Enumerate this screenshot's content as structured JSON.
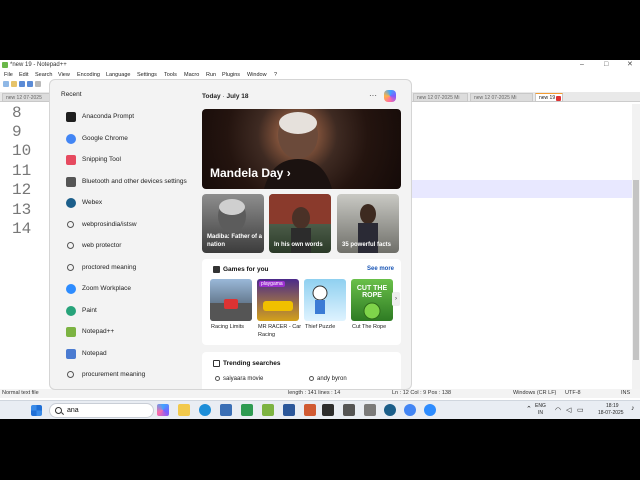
{
  "npp": {
    "title": "*new 19 - Notepad++",
    "controls": [
      "–",
      "□",
      "✕"
    ],
    "menu": [
      "File",
      "Edit",
      "Search",
      "View",
      "Encoding",
      "Language",
      "Settings",
      "Tools",
      "Macro",
      "Run",
      "Plugins",
      "Window",
      "?"
    ],
    "tabs": [
      "new 12 07-2025",
      "new 12 07-2025 Mi",
      "new 12 07-2025 Mi",
      "new 19"
    ],
    "line_numbers": [
      "8",
      "9",
      "10",
      "11",
      "12",
      "13",
      "14"
    ],
    "status": {
      "type": "Normal text file",
      "length": "length : 141   lines : 14",
      "pos": "Ln : 12   Col : 9   Pos : 138",
      "eol": "Windows (CR LF)",
      "enc": "UTF-8",
      "mode": "INS"
    }
  },
  "start": {
    "recent_title": "Recent",
    "recent": [
      {
        "label": "Anaconda Prompt",
        "icon": "terminal-icon",
        "color": "#1e1e1e"
      },
      {
        "label": "Google Chrome",
        "icon": "chrome-icon",
        "color": "#4285f4"
      },
      {
        "label": "Snipping Tool",
        "icon": "scissors-icon",
        "color": "#e64a5f"
      },
      {
        "label": "Bluetooth and other devices settings",
        "icon": "bluetooth-icon",
        "color": "#555555"
      },
      {
        "label": "Webex",
        "icon": "webex-icon",
        "color": "#1b5e8a"
      },
      {
        "label": "webprosindia/istsw",
        "icon": "search-icon",
        "color": ""
      },
      {
        "label": "web protector",
        "icon": "search-icon",
        "color": ""
      },
      {
        "label": "proctored meaning",
        "icon": "search-icon",
        "color": ""
      },
      {
        "label": "Zoom Workplace",
        "icon": "zoom-icon",
        "color": "#2d8cff"
      },
      {
        "label": "Paint",
        "icon": "paint-icon",
        "color": "#27a37a"
      },
      {
        "label": "Notepad++",
        "icon": "notepadpp-icon",
        "color": "#7cb342"
      },
      {
        "label": "Notepad",
        "icon": "notepad-icon",
        "color": "#4a7bd1"
      },
      {
        "label": "procurement meaning",
        "icon": "search-icon",
        "color": ""
      }
    ],
    "feed": {
      "today": "Today",
      "date": "July 18",
      "more": "···",
      "hero_title": "Mandela Day",
      "tiles": [
        "Madiba: Father of a nation",
        "In his own words",
        "35 powerful facts"
      ],
      "games_title": "Games for you",
      "see_more": "See more",
      "games": [
        {
          "name": "Racing Limits",
          "banner": ""
        },
        {
          "name": "MR RACER - Car Racing",
          "banner": "playgama"
        },
        {
          "name": "Thief Puzzle",
          "banner": ""
        },
        {
          "name": "Cut The Rope",
          "banner": "CUT THE ROPE"
        }
      ],
      "trending_title": "Trending searches",
      "trending": [
        "saiyaara movie",
        "andy byron"
      ]
    }
  },
  "taskbar": {
    "search_query": "ana",
    "tray": {
      "lang": "ENG",
      "region": "IN",
      "time": "18:19",
      "date": "18-07-2025"
    }
  },
  "colors": {
    "accent_orange": "#f39c32",
    "line_highlight": "#e8e8ff",
    "link_blue": "#1a56b5"
  }
}
